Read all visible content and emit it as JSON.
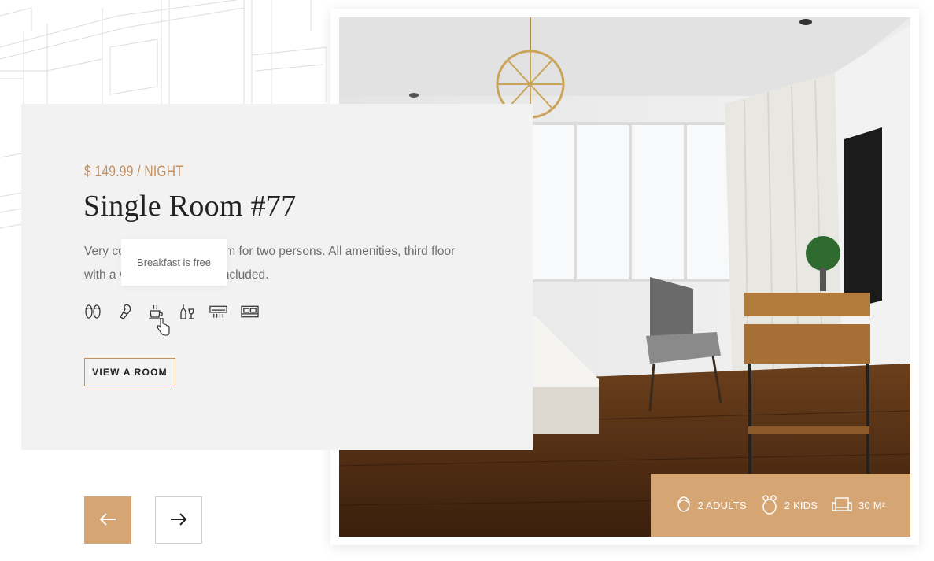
{
  "room": {
    "price": "$ 149.99 / NIGHT",
    "title": "Single Room #77",
    "description": "Very cozy and elegant room for two persons. All amenities, third floor with a view and cleaning included.",
    "view_button": "VIEW A ROOM"
  },
  "tooltip": {
    "text": "Breakfast is free"
  },
  "amenities": [
    "slippers-icon",
    "hairdryer-icon",
    "breakfast-icon",
    "drinks-icon",
    "air-conditioner-icon",
    "bed-icon"
  ],
  "info": {
    "adults": "2 ADULTS",
    "kids": "2 KIDS",
    "area": "30 M²"
  },
  "navigation": {
    "prev": "prev-arrow-icon",
    "next": "next-arrow-icon"
  },
  "colors": {
    "accent": "#d5a574",
    "price": "#c4905f",
    "card_bg": "#f2f2f2"
  }
}
